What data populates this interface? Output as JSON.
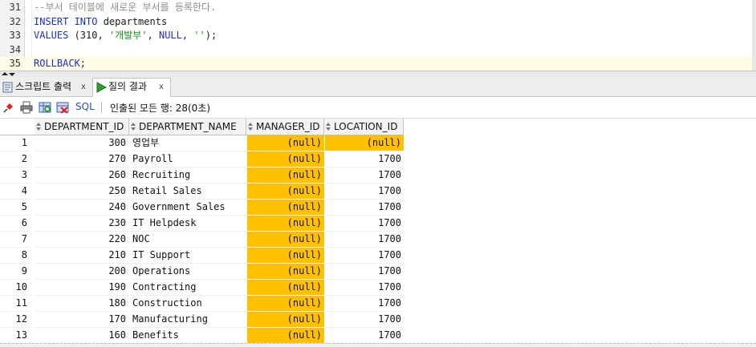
{
  "editor": {
    "lines": [
      {
        "num": "31",
        "tokens": [
          {
            "t": "--부서 테이블에 새로운 부서를 등록한다.",
            "c": "cmt"
          }
        ]
      },
      {
        "num": "32",
        "tokens": [
          {
            "t": "INSERT INTO ",
            "c": "kw"
          },
          {
            "t": "departments",
            "c": "id"
          }
        ]
      },
      {
        "num": "33",
        "tokens": [
          {
            "t": "VALUES ",
            "c": "kw"
          },
          {
            "t": "(310, ",
            "c": "num"
          },
          {
            "t": "'개발부'",
            "c": "str"
          },
          {
            "t": ", ",
            "c": "id"
          },
          {
            "t": "NULL",
            "c": "kw"
          },
          {
            "t": ", ",
            "c": "id"
          },
          {
            "t": "''",
            "c": "str"
          },
          {
            "t": ");",
            "c": "id"
          }
        ]
      },
      {
        "num": "34",
        "tokens": []
      },
      {
        "num": "35",
        "tokens": [
          {
            "t": "ROLLBACK",
            "c": "kw"
          },
          {
            "t": ";",
            "c": "id"
          }
        ]
      }
    ]
  },
  "tabs": {
    "script_output": "스크립트 출력",
    "query_result": "질의 결과",
    "close": "x"
  },
  "toolbar": {
    "sql_label": "SQL",
    "status": "인출된 모든 행: 28(0초)"
  },
  "grid": {
    "columns": [
      "DEPARTMENT_ID",
      "DEPARTMENT_NAME",
      "MANAGER_ID",
      "LOCATION_ID"
    ],
    "rows": [
      {
        "rn": "1",
        "id": "300",
        "name": "영업부",
        "mgr": "(null)",
        "loc": "(null)"
      },
      {
        "rn": "2",
        "id": "270",
        "name": "Payroll",
        "mgr": "(null)",
        "loc": "1700"
      },
      {
        "rn": "3",
        "id": "260",
        "name": "Recruiting",
        "mgr": "(null)",
        "loc": "1700"
      },
      {
        "rn": "4",
        "id": "250",
        "name": "Retail Sales",
        "mgr": "(null)",
        "loc": "1700"
      },
      {
        "rn": "5",
        "id": "240",
        "name": "Government Sales",
        "mgr": "(null)",
        "loc": "1700"
      },
      {
        "rn": "6",
        "id": "230",
        "name": "IT Helpdesk",
        "mgr": "(null)",
        "loc": "1700"
      },
      {
        "rn": "7",
        "id": "220",
        "name": "NOC",
        "mgr": "(null)",
        "loc": "1700"
      },
      {
        "rn": "8",
        "id": "210",
        "name": "IT Support",
        "mgr": "(null)",
        "loc": "1700"
      },
      {
        "rn": "9",
        "id": "200",
        "name": "Operations",
        "mgr": "(null)",
        "loc": "1700"
      },
      {
        "rn": "10",
        "id": "190",
        "name": "Contracting",
        "mgr": "(null)",
        "loc": "1700"
      },
      {
        "rn": "11",
        "id": "180",
        "name": "Construction",
        "mgr": "(null)",
        "loc": "1700"
      },
      {
        "rn": "12",
        "id": "170",
        "name": "Manufacturing",
        "mgr": "(null)",
        "loc": "1700"
      },
      {
        "rn": "13",
        "id": "160",
        "name": "Benefits",
        "mgr": "(null)",
        "loc": "1700"
      }
    ]
  },
  "colors": {
    "null_highlight": "#ffc000",
    "keyword": "#1c2fc4",
    "string": "#1c8a1c",
    "comment": "#8e8e8e"
  },
  "icons": [
    "pin-icon",
    "print-icon",
    "refresh-icon",
    "delete-icon",
    "run-icon",
    "script-icon",
    "sort-icon"
  ]
}
